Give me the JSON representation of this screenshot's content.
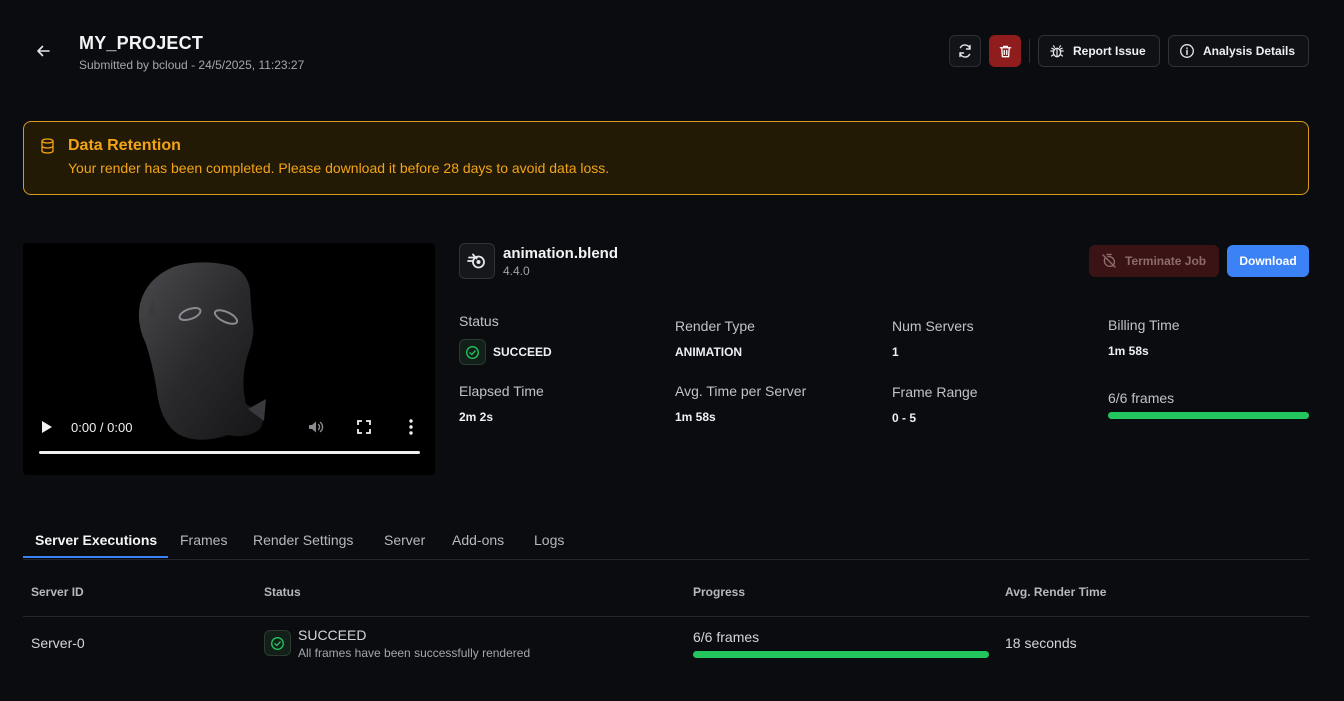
{
  "header": {
    "title": "MY_PROJECT",
    "subtitle": "Submitted by bcloud - 24/5/2025, 11:23:27",
    "report_label": "Report Issue",
    "analysis_label": "Analysis Details"
  },
  "banner": {
    "title": "Data Retention",
    "message": "Your render has been completed. Please download it before 28 days to avoid data loss."
  },
  "video": {
    "time": "0:00 / 0:00"
  },
  "file": {
    "name": "animation.blend",
    "version": "4.4.0"
  },
  "actions": {
    "terminate_label": "Terminate Job",
    "download_label": "Download"
  },
  "stats": {
    "status_label": "Status",
    "status_value": "SUCCEED",
    "render_type_label": "Render Type",
    "render_type_value": "ANIMATION",
    "num_servers_label": "Num Servers",
    "num_servers_value": "1",
    "billing_time_label": "Billing Time",
    "billing_time_value": "1m 58s",
    "elapsed_label": "Elapsed Time",
    "elapsed_value": "2m 2s",
    "avg_time_label": "Avg. Time per Server",
    "avg_time_value": "1m 58s",
    "frame_range_label": "Frame Range",
    "frame_range_value": "0 - 5",
    "frames_progress_label": "6/6 frames",
    "frames_progress_fraction": 1.0
  },
  "tabs": [
    {
      "label": "Server Executions"
    },
    {
      "label": "Frames"
    },
    {
      "label": "Render Settings"
    },
    {
      "label": "Server"
    },
    {
      "label": "Add-ons"
    },
    {
      "label": "Logs"
    }
  ],
  "table": {
    "headers": [
      "Server ID",
      "Status",
      "Progress",
      "Avg. Render Time"
    ],
    "rows": [
      {
        "server_id": "Server-0",
        "status": "SUCCEED",
        "status_detail": "All frames have been successfully rendered",
        "progress": "6/6 frames",
        "progress_fraction": 1.0,
        "avg_render_time": "18 seconds"
      }
    ]
  },
  "colors": {
    "accent": "#3b82f6",
    "success": "#22c55e",
    "warning": "#f2a418",
    "danger": "#8f1d1d"
  }
}
